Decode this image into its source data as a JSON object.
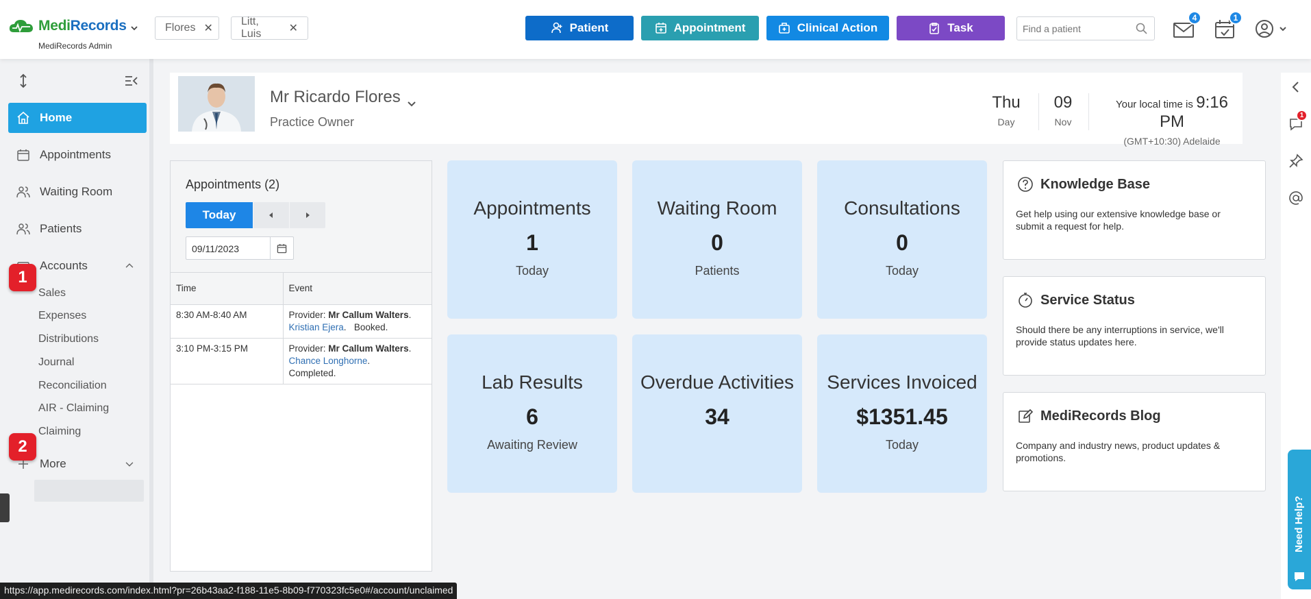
{
  "topbar": {
    "brand_a": "Medi",
    "brand_b": "Records",
    "subtitle": "MediRecords Admin",
    "chips": [
      {
        "label": "Flores"
      },
      {
        "label": "Litt, Luis"
      }
    ],
    "actions": [
      {
        "label": "Patient",
        "color": "#0d6cc9"
      },
      {
        "label": "Appointment",
        "color": "#2a9fb0"
      },
      {
        "label": "Clinical Action",
        "color": "#1289e3"
      },
      {
        "label": "Task",
        "color": "#7c49c5"
      }
    ],
    "search_placeholder": "Find a patient",
    "mail_badge": "4",
    "task_badge": "1"
  },
  "sidebar": {
    "nav": [
      {
        "label": "Home",
        "icon": "home-icon"
      },
      {
        "label": "Appointments",
        "icon": "calendar-icon"
      },
      {
        "label": "Waiting Room",
        "icon": "users-icon"
      },
      {
        "label": "Patients",
        "icon": "users-icon"
      },
      {
        "label": "Accounts",
        "icon": "wallet-icon"
      },
      {
        "label": "More",
        "icon": "plus-icon"
      }
    ],
    "accounts_sub": [
      "Sales",
      "Expenses",
      "Distributions",
      "Journal",
      "Reconciliation",
      "AIR - Claiming",
      "Claiming"
    ],
    "markers": [
      "1",
      "2"
    ]
  },
  "profile": {
    "name": "Mr Ricardo Flores",
    "role": "Practice Owner",
    "day_name": "Thu",
    "day_label": "Day",
    "day_num": "09",
    "month": "Nov",
    "time_prefix": "Your local time is",
    "time": "9:16 PM",
    "timezone": "(GMT+10:30) Adelaide"
  },
  "appointments": {
    "title": "Appointments (2)",
    "today_label": "Today",
    "date": "09/11/2023",
    "col_time": "Time",
    "col_event": "Event",
    "rows": [
      {
        "time": "8:30 AM-8:40 AM",
        "provider_label": "Provider:",
        "provider": "Mr Callum Walters",
        "patient": "Kristian Ejera",
        "status": "Booked."
      },
      {
        "time": "3:10 PM-3:15 PM",
        "provider_label": "Provider:",
        "provider": "Mr Callum Walters",
        "patient": "Chance Longhorne",
        "status": "Completed."
      }
    ]
  },
  "tiles": [
    {
      "title": "Appointments",
      "value": "1",
      "sub": "Today"
    },
    {
      "title": "Waiting Room",
      "value": "0",
      "sub": "Patients"
    },
    {
      "title": "Consultations",
      "value": "0",
      "sub": "Today"
    },
    {
      "title": "Lab Results",
      "value": "6",
      "sub": "Awaiting Review"
    },
    {
      "title": "Overdue Activities",
      "value": "34",
      "sub": ""
    },
    {
      "title": "Services Invoiced",
      "value": "$1351.45",
      "sub": "Today"
    }
  ],
  "cards": [
    {
      "title": "Knowledge Base",
      "body": "Get help using our extensive knowledge base or submit a request for help."
    },
    {
      "title": "Service Status",
      "body": "Should there be any interruptions in service, we'll provide status updates here."
    },
    {
      "title": "MediRecords Blog",
      "body": "Company and industry news, product updates & promotions."
    }
  ],
  "rail": {
    "chat_badge": "1"
  },
  "help_label": "Need Help?",
  "status_url": "https://app.medirecords.com/index.html?pr=26b43aa2-f188-11e5-8b09-f770323fc5e0#/account/unclaimed"
}
